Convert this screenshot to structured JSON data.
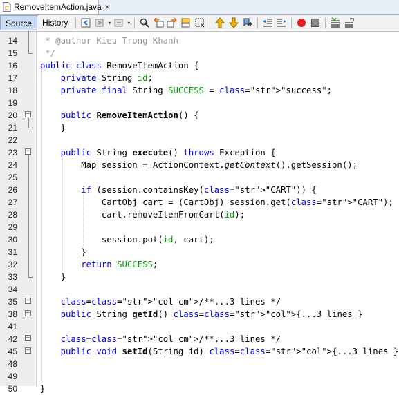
{
  "tab": {
    "filename": "RemoveItemAction.java",
    "close": "×"
  },
  "toolbar": {
    "source_label": "Source",
    "history_label": "History",
    "icons": [
      "back-history-icon",
      "forward-icon",
      "dropdown-icon",
      "last-edit-icon",
      "dropdown-icon",
      "find-icon",
      "find-previous-icon",
      "find-next-icon",
      "toggle-highlight-icon",
      "toggle-rect-selection-icon",
      "previous-bookmark-icon",
      "next-bookmark-icon",
      "toggle-bookmark-icon",
      "shift-left-icon",
      "shift-right-icon",
      "start-macro-icon",
      "stop-macro-icon",
      "comment-icon",
      "uncomment-icon"
    ]
  },
  "colors": {
    "keyword": "#0000e6",
    "string": "#ce7b00",
    "field": "#009900",
    "comment": "#969696"
  },
  "code": {
    "lines": [
      {
        "n": "14",
        "t": " * @author Kieu Trong Khanh"
      },
      {
        "n": "15",
        "t": " */"
      },
      {
        "n": "16",
        "t": "public class RemoveItemAction {"
      },
      {
        "n": "17",
        "t": "    private String id;"
      },
      {
        "n": "18",
        "t": "    private final String SUCCESS = \"success\";"
      },
      {
        "n": "19",
        "t": ""
      },
      {
        "n": "20",
        "t": "    public RemoveItemAction() {"
      },
      {
        "n": "21",
        "t": "    }"
      },
      {
        "n": "22",
        "t": ""
      },
      {
        "n": "23",
        "t": "    public String execute() throws Exception {"
      },
      {
        "n": "24",
        "t": "        Map session = ActionContext.getContext().getSession();"
      },
      {
        "n": "25",
        "t": ""
      },
      {
        "n": "26",
        "t": "        if (session.containsKey(\"CART\")) {"
      },
      {
        "n": "27",
        "t": "            CartObj cart = (CartObj) session.get(\"CART\");"
      },
      {
        "n": "28",
        "t": "            cart.removeItemFromCart(id);"
      },
      {
        "n": "29",
        "t": ""
      },
      {
        "n": "30",
        "t": "            session.put(id, cart);"
      },
      {
        "n": "31",
        "t": "        }"
      },
      {
        "n": "32",
        "t": "        return SUCCESS;"
      },
      {
        "n": "33",
        "t": "    }"
      },
      {
        "n": "34",
        "t": ""
      },
      {
        "n": "35",
        "t": "    /**...3 lines */"
      },
      {
        "n": "38",
        "t": "    public String getId() {...3 lines }"
      },
      {
        "n": "41",
        "t": ""
      },
      {
        "n": "42",
        "t": "    /**...3 lines */"
      },
      {
        "n": "45",
        "t": "    public void setId(String id) {...3 lines }"
      },
      {
        "n": "48",
        "t": ""
      },
      {
        "n": "49",
        "t": ""
      },
      {
        "n": "50",
        "t": "}"
      }
    ]
  }
}
